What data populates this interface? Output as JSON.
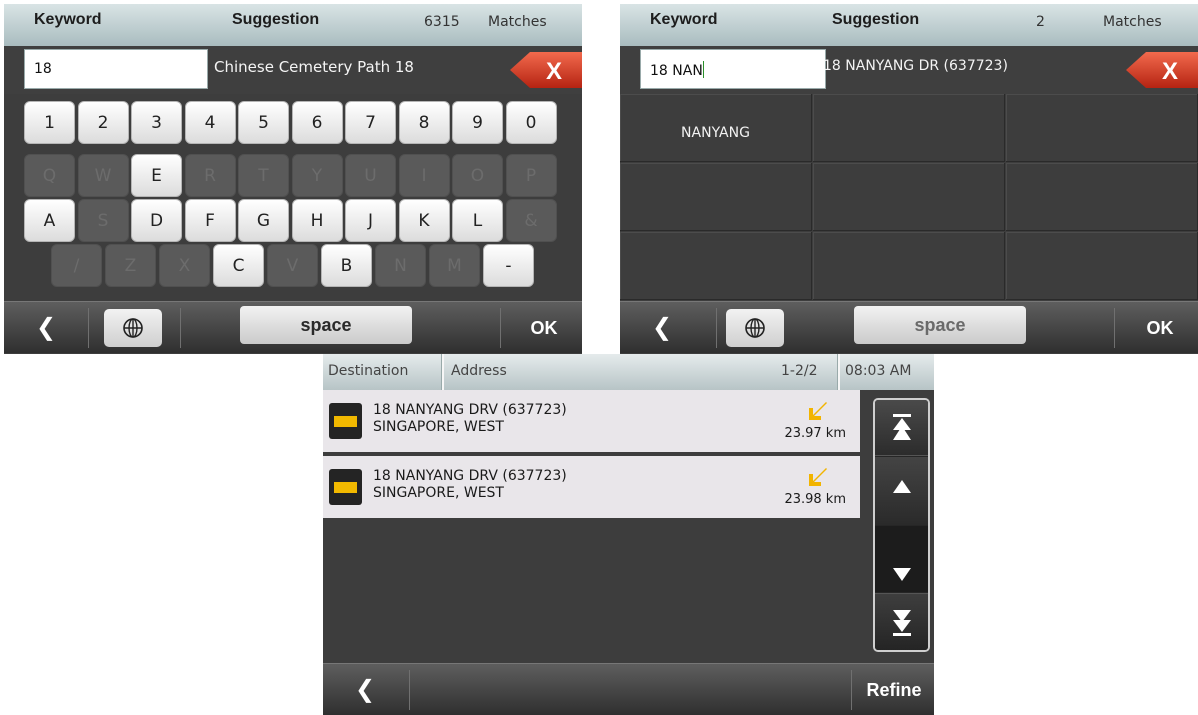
{
  "panel1": {
    "header": {
      "keyword": "Keyword",
      "suggestion": "Suggestion",
      "count": "6315",
      "matches": "Matches"
    },
    "keyword_value": "18",
    "suggestion_value": "Chinese Cemetery Path 18",
    "clear_label": "X",
    "keyboard": {
      "row1": [
        "1",
        "2",
        "3",
        "4",
        "5",
        "6",
        "7",
        "8",
        "9",
        "0"
      ],
      "row2": [
        "Q",
        "W",
        "E",
        "R",
        "T",
        "Y",
        "U",
        "I",
        "O",
        "P"
      ],
      "row3": [
        "A",
        "S",
        "D",
        "F",
        "G",
        "H",
        "J",
        "K",
        "L",
        "&"
      ],
      "row4": [
        "/",
        "Z",
        "X",
        "C",
        "V",
        "B",
        "N",
        "M",
        "-"
      ]
    },
    "bottom": {
      "back": "❮",
      "space": "space",
      "ok": "OK"
    }
  },
  "panel2": {
    "header": {
      "keyword": "Keyword",
      "suggestion": "Suggestion",
      "count": "2",
      "matches": "Matches"
    },
    "keyword_value": "18 NAN",
    "suggestion_value": "18 NANYANG DR (637723)",
    "clear_label": "X",
    "cells": [
      "NANYANG"
    ],
    "bottom": {
      "back": "❮",
      "space": "space",
      "ok": "OK"
    }
  },
  "panel3": {
    "header": {
      "destination": "Destination",
      "address": "Address",
      "range": "1-2/2",
      "time": "08:03 AM"
    },
    "results": [
      {
        "line1": "18 NANYANG DRV (637723)",
        "line2": "SINGAPORE, WEST",
        "distance": "23.97 km"
      },
      {
        "line1": "18 NANYANG DRV (637723)",
        "line2": "SINGAPORE, WEST",
        "distance": "23.98 km"
      }
    ],
    "bottom": {
      "back": "❮",
      "refine": "Refine"
    }
  },
  "colors": {
    "accent_red": "#d7311d",
    "header": "#bfcfd1",
    "result_bg": "#e9e6ea",
    "poi_yellow": "#f2b900"
  }
}
